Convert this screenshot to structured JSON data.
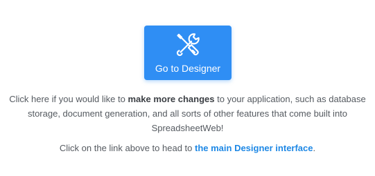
{
  "designer_button": {
    "label": "Go to Designer",
    "icon": "tools-icon",
    "color": "#2f8ef4"
  },
  "description": {
    "before": "Click here if you would like to ",
    "emphasis": "make more changes",
    "line1_after": " to your application, such as database",
    "line2": "storage, document generation, and all sorts of other features that come built into",
    "line3": "SpreadsheetWeb!"
  },
  "link_text": {
    "before": "Click on the link above to head to ",
    "link": "the main Designer interface",
    "after": ".",
    "link_color": "#1e88e5"
  }
}
